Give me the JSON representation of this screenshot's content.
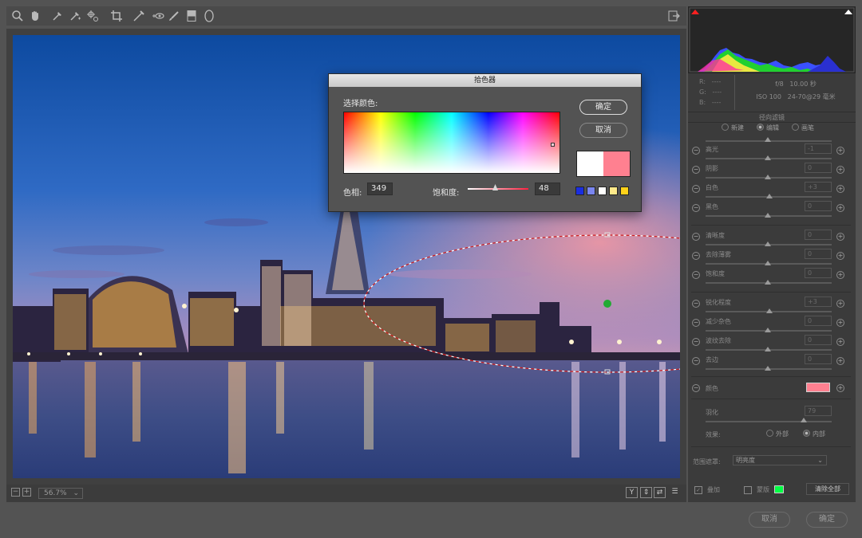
{
  "toolbar": {
    "tools": [
      "zoom-icon",
      "hand-icon",
      "white-balance-icon",
      "color-sampler-icon",
      "targeted-adjust-icon",
      "crop-icon",
      "straighten-icon",
      "red-eye-icon",
      "brush-icon",
      "graduated-filter-icon",
      "radial-filter-icon"
    ],
    "export_icon": "export-icon"
  },
  "zoom": {
    "level": "56.7%"
  },
  "info": {
    "r_label": "R:",
    "g_label": "G:",
    "b_label": "B:",
    "r_value": "----",
    "g_value": "----",
    "b_value": "----",
    "aperture": "f/8",
    "shutter": "10.00 秒",
    "iso": "ISO 100",
    "lens": "24-70@29 毫米"
  },
  "panel": {
    "title": "径向滤镜",
    "modes": [
      "新建",
      "编辑",
      "画笔"
    ],
    "selected_mode": "编辑",
    "sliders_group1": [
      {
        "label": "高光",
        "value": "-1"
      },
      {
        "label": "阴影",
        "value": "0"
      },
      {
        "label": "白色",
        "value": "+3"
      },
      {
        "label": "黑色",
        "value": "0"
      }
    ],
    "sliders_group2": [
      {
        "label": "清晰度",
        "value": "0"
      },
      {
        "label": "去除薄雾",
        "value": "0"
      },
      {
        "label": "饱和度",
        "value": "0"
      }
    ],
    "sliders_group3": [
      {
        "label": "锐化程度",
        "value": "+3"
      },
      {
        "label": "减少杂色",
        "value": "0"
      },
      {
        "label": "波纹去除",
        "value": "0"
      },
      {
        "label": "去边",
        "value": "0"
      }
    ],
    "color_label": "颜色",
    "color_value": "#ff8090",
    "feather_label": "羽化",
    "feather_value": "79",
    "effect_label": "效果:",
    "effect_outer": "外部",
    "effect_inner": "内部",
    "effect_selected": "内部",
    "range_mask_label": "范围遮罩:",
    "range_mask_value": "明亮度",
    "overlay_label": "叠加",
    "mask_label": "蒙版",
    "mask_color": "#00ff44",
    "clear_all": "清除全部"
  },
  "footer": {
    "cancel": "取消",
    "ok": "确定"
  },
  "view_buttons": [
    "Y",
    "before-after-icon",
    "swap-icon",
    "settings-icon"
  ],
  "dialog": {
    "title": "拾色器",
    "select_color_label": "选择颜色:",
    "ok_label": "确定",
    "cancel_label": "取消",
    "hue_label": "色相:",
    "hue_value": "349",
    "saturation_label": "饱和度:",
    "saturation_value": "48",
    "preview_old": "#ffffff",
    "preview_new": "#ff8090",
    "swatches": [
      "#1a2ee0",
      "#7a86f0",
      "#ffffff",
      "#ffe98a",
      "#ffd21a"
    ]
  }
}
